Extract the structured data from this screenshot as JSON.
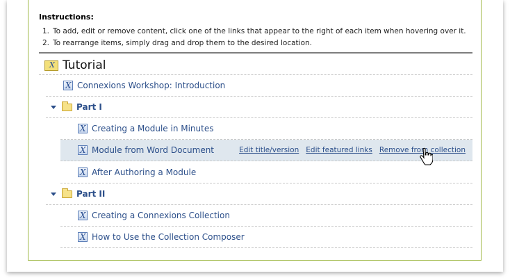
{
  "instructions": {
    "title": "Instructions:",
    "items": [
      {
        "num": "1.",
        "text": "To add, edit or remove content, click one of the links that appear to the right of each item when hovering over it."
      },
      {
        "num": "2.",
        "text": "To rearrange items, simply drag and drop them to the desired location."
      }
    ]
  },
  "collection": {
    "title": "Tutorial",
    "icon": "collection-icon"
  },
  "rows": [
    {
      "label": "Connexions Workshop: Introduction"
    },
    {
      "label": "Part I"
    },
    {
      "label": "Creating a Module in Minutes"
    },
    {
      "label": "Module from Word Document"
    },
    {
      "label": "After Authoring a Module"
    },
    {
      "label": "Part II"
    },
    {
      "label": "Creating a Connexions Collection"
    },
    {
      "label": "How to Use the Collection Composer"
    }
  ],
  "hover_links": {
    "edit_title": "Edit title/version",
    "edit_featured": "Edit featured links",
    "remove": "Remove from collection"
  },
  "colors": {
    "link": "#2c4f8a",
    "hover_row": "#dfe7ee",
    "frame_border": "#9fb845"
  }
}
